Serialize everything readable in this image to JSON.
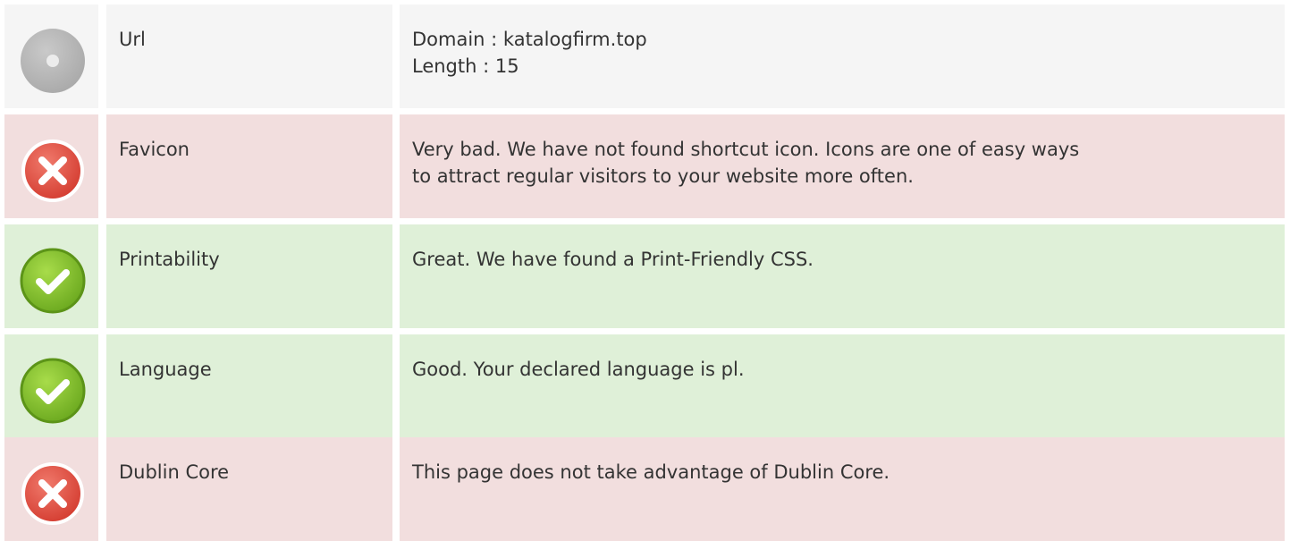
{
  "rows": [
    {
      "status": "neutral",
      "label": "Url",
      "lines": [
        "Domain : katalogfirm.top",
        "Length : 15"
      ]
    },
    {
      "status": "bad",
      "label": "Favicon",
      "lines": [
        "Very bad. We have not found shortcut icon. Icons are one of easy ways",
        "to attract regular visitors to your website more often."
      ]
    },
    {
      "status": "good",
      "label": "Printability",
      "lines": [
        "Great. We have found a Print-Friendly CSS."
      ]
    },
    {
      "status": "good",
      "label": "Language",
      "lines": [
        "Good. Your declared language is pl."
      ]
    },
    {
      "status": "bad",
      "label": "Dublin Core",
      "lines": [
        "This page does not take advantage of Dublin Core."
      ]
    }
  ],
  "colors": {
    "neutral_bg": "#f5f5f5",
    "bad_bg": "#f2dede",
    "good_bg": "#dff0d8",
    "error_red": "#e14b3f",
    "success_green": "#7fbf2a",
    "neutral_grey": "#b8b8b8"
  },
  "icons": {
    "neutral": "info-dot-icon",
    "bad": "error-cross-icon",
    "good": "check-mark-icon"
  }
}
